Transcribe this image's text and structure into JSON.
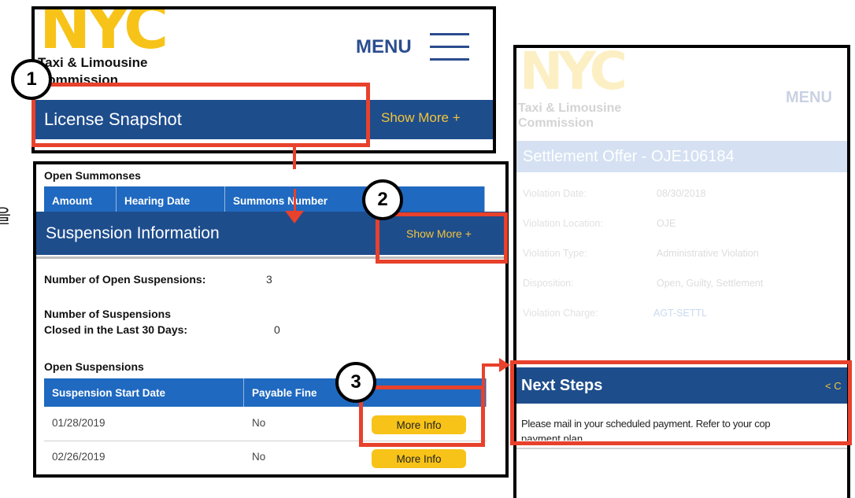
{
  "logo": {
    "wordmark": "NYC",
    "subtitle_line1": "Taxi & Limousine",
    "subtitle_line2": "Commission"
  },
  "menu": {
    "label": "MENU"
  },
  "license_bar": {
    "title": "License Snapshot",
    "show_more": "Show More +"
  },
  "open_summonses": {
    "heading": "Open Summonses",
    "columns": [
      "Amount",
      "Hearing Date",
      "Summons Number"
    ]
  },
  "suspension_bar": {
    "title": "Suspension Information",
    "show_more": "Show More +"
  },
  "suspension_counts": {
    "open_label": "Number of Open Suspensions:",
    "open_value": "3",
    "closed_label_line1": "Number of Suspensions",
    "closed_label_line2": "Closed in the Last 30 Days:",
    "closed_value": "0"
  },
  "open_suspensions": {
    "heading": "Open Suspensions",
    "columns": [
      "Suspension Start Date",
      "Payable Fine"
    ],
    "rows": [
      {
        "start_date": "01/28/2019",
        "payable": "No",
        "action": "More Info"
      },
      {
        "start_date": "02/26/2019",
        "payable": "No",
        "action": "More Info"
      }
    ]
  },
  "settlement": {
    "title": "Settlement Offer - OJE106184",
    "details": [
      {
        "label": "Violation Date:",
        "value": "08/30/2018"
      },
      {
        "label": "Violation Location:",
        "value": "OJE"
      },
      {
        "label": "Violation Type:",
        "value": "Administrative Violation"
      },
      {
        "label": "Disposition:",
        "value": "Open, Guilty, Settlement"
      },
      {
        "label": "Violation Charge:",
        "value": "AGT-SETTL"
      }
    ]
  },
  "next_steps": {
    "title": "Next Steps",
    "collapse": "< C",
    "text_line1": "Please mail in your scheduled payment. Refer to your cop",
    "text_line2": "payment plan."
  },
  "annotations": {
    "badge1": "1",
    "badge2": "2",
    "badge3": "3",
    "side_glyph": "을"
  },
  "colors": {
    "nyc_yellow": "#f7c318",
    "bar_blue": "#1e4d8c",
    "header_blue": "#1f69c0",
    "callout_red": "#e8412c"
  }
}
